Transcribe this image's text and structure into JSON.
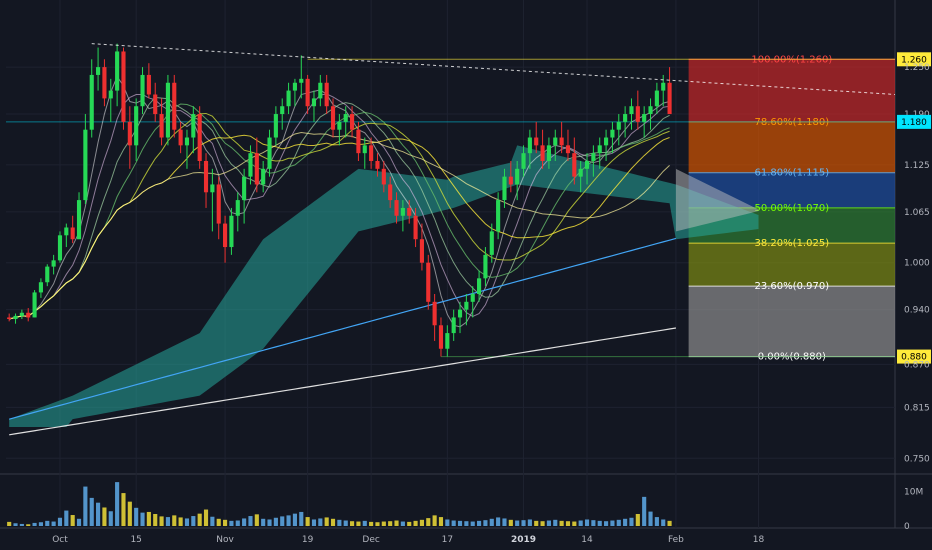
{
  "chart_data": {
    "type": "candlestick",
    "price_ylim": [
      0.735,
      1.3
    ],
    "volume_ylim": [
      0,
      14
    ],
    "x_count": 140,
    "y_ticks": [
      {
        "label": "1.260",
        "v": 1.26,
        "badge": true,
        "badge_color": "#ffeb3b",
        "badge_text": "#000000"
      },
      {
        "label": "1.250",
        "v": 1.25
      },
      {
        "label": "1.190",
        "v": 1.19
      },
      {
        "label": "1.180",
        "v": 1.18,
        "badge": true,
        "badge_color": "#00e5ff",
        "badge_text": "#000000"
      },
      {
        "label": "1.125",
        "v": 1.125
      },
      {
        "label": "1.065",
        "v": 1.065
      },
      {
        "label": "1.000",
        "v": 1.0
      },
      {
        "label": "0.940",
        "v": 0.94
      },
      {
        "label": "0.880",
        "v": 0.88,
        "badge": true,
        "badge_color": "#ffeb3b",
        "badge_text": "#000000"
      },
      {
        "label": "0.870",
        "v": 0.87
      },
      {
        "label": "0.815",
        "v": 0.815
      },
      {
        "label": "0.750",
        "v": 0.75
      }
    ],
    "volume_ticks": [
      {
        "label": "10M",
        "v": 10
      },
      {
        "label": "0",
        "v": 0
      }
    ],
    "x_ticks": [
      {
        "label": "Oct",
        "i": 8
      },
      {
        "label": "15",
        "i": 20
      },
      {
        "label": "Nov",
        "i": 34
      },
      {
        "label": "19",
        "i": 47
      },
      {
        "label": "Dec",
        "i": 57
      },
      {
        "label": "17",
        "i": 69
      },
      {
        "label": "2019",
        "i": 81,
        "bold": true
      },
      {
        "label": "14",
        "i": 91
      },
      {
        "label": "Feb",
        "i": 105
      },
      {
        "label": "18",
        "i": 118
      }
    ],
    "fib_levels": [
      {
        "ratio": "100.00%",
        "price": 1.26,
        "label": "100.00%(1.260)",
        "color": "#c62828",
        "text": "#ff4444"
      },
      {
        "ratio": "78.60%",
        "price": 1.18,
        "label": "78.60%(1.180)",
        "color": "#d35400",
        "text": "#ff9800"
      },
      {
        "ratio": "61.80%",
        "price": 1.115,
        "label": "61.80%(1.115)",
        "color": "#1e4fa0",
        "text": "#64b5f6"
      },
      {
        "ratio": "50.00%",
        "price": 1.07,
        "label": "50.00%(1.070)",
        "color": "#2e7d32",
        "text": "#76ff03"
      },
      {
        "ratio": "38.20%",
        "price": 1.025,
        "label": "38.20%(1.025)",
        "color": "#7c8a12",
        "text": "#ffeb3b"
      },
      {
        "ratio": "23.60%",
        "price": 0.97,
        "label": "23.60%(0.970)",
        "color": "#8d8d8d",
        "text": "#ffffff"
      },
      {
        "ratio": "0.00%",
        "price": 0.88,
        "label": "0.00%(0.880)",
        "color": "#ffffff",
        "text": "#ffffff"
      }
    ],
    "candles": [
      [
        0,
        0.93,
        0.935,
        0.925,
        0.928
      ],
      [
        1,
        0.928,
        0.935,
        0.922,
        0.932
      ],
      [
        2,
        0.932,
        0.94,
        0.928,
        0.936
      ],
      [
        3,
        0.936,
        0.942,
        0.925,
        0.93
      ],
      [
        4,
        0.93,
        0.965,
        0.93,
        0.962
      ],
      [
        5,
        0.962,
        0.98,
        0.955,
        0.975
      ],
      [
        6,
        0.975,
        0.998,
        0.97,
        0.995
      ],
      [
        7,
        0.995,
        1.01,
        0.985,
        1.003
      ],
      [
        8,
        1.003,
        1.04,
        1.0,
        1.035
      ],
      [
        9,
        1.035,
        1.05,
        1.02,
        1.045
      ],
      [
        10,
        1.045,
        1.06,
        1.025,
        1.03
      ],
      [
        11,
        1.03,
        1.09,
        1.03,
        1.08
      ],
      [
        12,
        1.08,
        1.19,
        1.075,
        1.17
      ],
      [
        13,
        1.17,
        1.26,
        1.16,
        1.24
      ],
      [
        14,
        1.24,
        1.275,
        1.22,
        1.25
      ],
      [
        15,
        1.25,
        1.26,
        1.2,
        1.21
      ],
      [
        16,
        1.21,
        1.235,
        1.18,
        1.22
      ],
      [
        17,
        1.22,
        1.28,
        1.2,
        1.27
      ],
      [
        18,
        1.27,
        1.275,
        1.17,
        1.18
      ],
      [
        19,
        1.18,
        1.2,
        1.12,
        1.15
      ],
      [
        20,
        1.15,
        1.21,
        1.13,
        1.2
      ],
      [
        21,
        1.2,
        1.25,
        1.19,
        1.24
      ],
      [
        22,
        1.24,
        1.255,
        1.21,
        1.215
      ],
      [
        23,
        1.215,
        1.23,
        1.18,
        1.19
      ],
      [
        24,
        1.19,
        1.21,
        1.15,
        1.16
      ],
      [
        25,
        1.16,
        1.24,
        1.15,
        1.23
      ],
      [
        26,
        1.23,
        1.24,
        1.16,
        1.17
      ],
      [
        27,
        1.17,
        1.18,
        1.14,
        1.15
      ],
      [
        28,
        1.15,
        1.17,
        1.12,
        1.16
      ],
      [
        29,
        1.16,
        1.2,
        1.14,
        1.19
      ],
      [
        30,
        1.19,
        1.2,
        1.12,
        1.13
      ],
      [
        31,
        1.13,
        1.14,
        1.07,
        1.09
      ],
      [
        32,
        1.09,
        1.12,
        1.04,
        1.1
      ],
      [
        33,
        1.1,
        1.11,
        1.03,
        1.05
      ],
      [
        34,
        1.05,
        1.06,
        1.0,
        1.02
      ],
      [
        35,
        1.02,
        1.07,
        1.01,
        1.06
      ],
      [
        36,
        1.06,
        1.09,
        1.04,
        1.08
      ],
      [
        37,
        1.08,
        1.12,
        1.05,
        1.11
      ],
      [
        38,
        1.11,
        1.15,
        1.1,
        1.14
      ],
      [
        39,
        1.14,
        1.16,
        1.09,
        1.1
      ],
      [
        40,
        1.1,
        1.13,
        1.09,
        1.12
      ],
      [
        41,
        1.12,
        1.17,
        1.11,
        1.16
      ],
      [
        42,
        1.16,
        1.2,
        1.15,
        1.19
      ],
      [
        43,
        1.19,
        1.21,
        1.17,
        1.2
      ],
      [
        44,
        1.2,
        1.23,
        1.19,
        1.22
      ],
      [
        45,
        1.22,
        1.235,
        1.2,
        1.23
      ],
      [
        46,
        1.23,
        1.265,
        1.21,
        1.235
      ],
      [
        47,
        1.235,
        1.24,
        1.19,
        1.2
      ],
      [
        48,
        1.2,
        1.22,
        1.18,
        1.21
      ],
      [
        49,
        1.21,
        1.24,
        1.2,
        1.23
      ],
      [
        50,
        1.23,
        1.24,
        1.19,
        1.2
      ],
      [
        51,
        1.2,
        1.21,
        1.16,
        1.17
      ],
      [
        52,
        1.17,
        1.19,
        1.15,
        1.18
      ],
      [
        53,
        1.18,
        1.2,
        1.16,
        1.19
      ],
      [
        54,
        1.19,
        1.2,
        1.16,
        1.17
      ],
      [
        55,
        1.17,
        1.18,
        1.13,
        1.14
      ],
      [
        56,
        1.14,
        1.16,
        1.12,
        1.15
      ],
      [
        57,
        1.15,
        1.16,
        1.12,
        1.13
      ],
      [
        58,
        1.13,
        1.14,
        1.11,
        1.12
      ],
      [
        59,
        1.12,
        1.13,
        1.09,
        1.1
      ],
      [
        60,
        1.1,
        1.11,
        1.07,
        1.08
      ],
      [
        61,
        1.08,
        1.09,
        1.05,
        1.06
      ],
      [
        62,
        1.06,
        1.08,
        1.04,
        1.07
      ],
      [
        63,
        1.07,
        1.08,
        1.05,
        1.06
      ],
      [
        64,
        1.06,
        1.07,
        1.02,
        1.03
      ],
      [
        65,
        1.03,
        1.05,
        0.99,
        1.0
      ],
      [
        66,
        1.0,
        1.01,
        0.94,
        0.95
      ],
      [
        67,
        0.95,
        0.96,
        0.9,
        0.92
      ],
      [
        68,
        0.92,
        0.93,
        0.88,
        0.89
      ],
      [
        69,
        0.89,
        0.92,
        0.88,
        0.91
      ],
      [
        70,
        0.91,
        0.94,
        0.9,
        0.93
      ],
      [
        71,
        0.93,
        0.95,
        0.91,
        0.94
      ],
      [
        72,
        0.94,
        0.96,
        0.92,
        0.95
      ],
      [
        73,
        0.95,
        0.97,
        0.93,
        0.96
      ],
      [
        74,
        0.96,
        0.99,
        0.95,
        0.98
      ],
      [
        75,
        0.98,
        1.02,
        0.97,
        1.01
      ],
      [
        76,
        1.01,
        1.05,
        1.0,
        1.04
      ],
      [
        77,
        1.04,
        1.09,
        1.03,
        1.08
      ],
      [
        78,
        1.08,
        1.12,
        1.07,
        1.11
      ],
      [
        79,
        1.11,
        1.13,
        1.09,
        1.1
      ],
      [
        80,
        1.1,
        1.13,
        1.08,
        1.12
      ],
      [
        81,
        1.12,
        1.15,
        1.11,
        1.14
      ],
      [
        82,
        1.14,
        1.17,
        1.12,
        1.16
      ],
      [
        83,
        1.16,
        1.18,
        1.14,
        1.15
      ],
      [
        84,
        1.15,
        1.17,
        1.12,
        1.13
      ],
      [
        85,
        1.13,
        1.16,
        1.12,
        1.15
      ],
      [
        86,
        1.15,
        1.17,
        1.13,
        1.16
      ],
      [
        87,
        1.16,
        1.18,
        1.14,
        1.15
      ],
      [
        88,
        1.15,
        1.17,
        1.13,
        1.14
      ],
      [
        89,
        1.14,
        1.16,
        1.1,
        1.11
      ],
      [
        90,
        1.11,
        1.13,
        1.09,
        1.12
      ],
      [
        91,
        1.12,
        1.14,
        1.1,
        1.13
      ],
      [
        92,
        1.13,
        1.15,
        1.11,
        1.14
      ],
      [
        93,
        1.14,
        1.16,
        1.12,
        1.15
      ],
      [
        94,
        1.15,
        1.17,
        1.13,
        1.16
      ],
      [
        95,
        1.16,
        1.18,
        1.14,
        1.17
      ],
      [
        96,
        1.17,
        1.19,
        1.15,
        1.18
      ],
      [
        97,
        1.18,
        1.2,
        1.16,
        1.19
      ],
      [
        98,
        1.19,
        1.21,
        1.17,
        1.2
      ],
      [
        99,
        1.2,
        1.22,
        1.17,
        1.18
      ],
      [
        100,
        1.18,
        1.2,
        1.16,
        1.19
      ],
      [
        101,
        1.19,
        1.21,
        1.17,
        1.2
      ],
      [
        102,
        1.2,
        1.23,
        1.19,
        1.22
      ],
      [
        103,
        1.22,
        1.24,
        1.2,
        1.23
      ],
      [
        104,
        1.23,
        1.25,
        1.21,
        1.19
      ]
    ],
    "volume": [
      1.2,
      0.8,
      0.6,
      0.5,
      0.9,
      1.1,
      1.5,
      1.3,
      2.4,
      4.5,
      3.2,
      2.1,
      11.5,
      8.2,
      6.8,
      5.4,
      4.3,
      12.8,
      9.6,
      7.1,
      5.3,
      3.9,
      4.1,
      3.5,
      2.8,
      2.6,
      3.1,
      2.5,
      2.2,
      2.9,
      3.6,
      4.8,
      2.7,
      2.1,
      1.8,
      1.5,
      1.6,
      2.2,
      2.9,
      3.4,
      2.1,
      1.9,
      2.4,
      2.8,
      3.1,
      3.6,
      4.1,
      2.6,
      1.9,
      2.2,
      2.5,
      2.1,
      1.8,
      1.6,
      1.4,
      1.3,
      1.5,
      1.2,
      1.1,
      1.3,
      1.4,
      1.6,
      1.3,
      1.2,
      1.5,
      1.8,
      2.3,
      3.1,
      2.6,
      1.9,
      1.6,
      1.5,
      1.4,
      1.3,
      1.5,
      1.7,
      2.1,
      2.5,
      2.2,
      1.8,
      1.6,
      1.7,
      1.9,
      1.5,
      1.4,
      1.6,
      1.8,
      1.5,
      1.4,
      1.3,
      1.6,
      1.9,
      1.7,
      1.5,
      1.4,
      1.6,
      1.8,
      2.1,
      2.4,
      3.5,
      8.5,
      4.2,
      2.6,
      1.9,
      1.5
    ]
  }
}
